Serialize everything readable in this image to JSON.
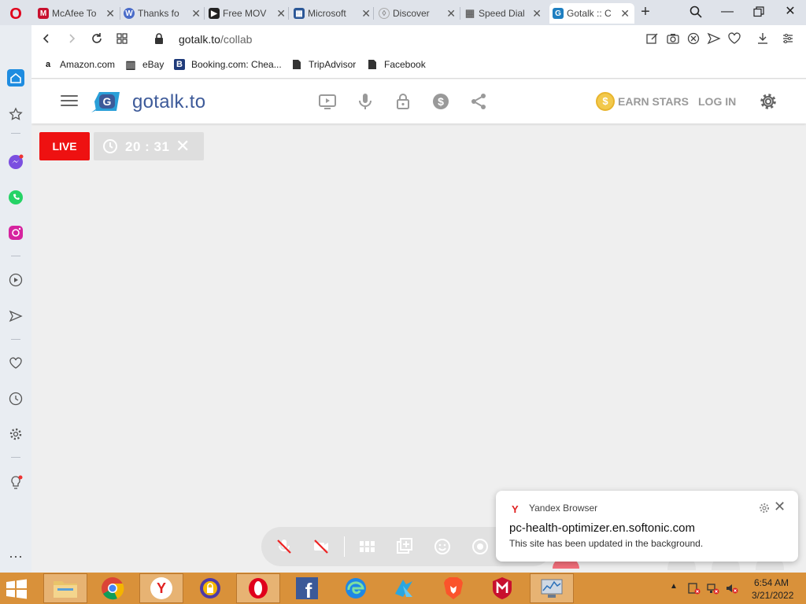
{
  "browser": {
    "logo_icon": "opera-logo-icon",
    "tabs": [
      {
        "title": "McAfee To",
        "favicon_color": "#c8102e",
        "favicon_glyph": "M",
        "active": false
      },
      {
        "title": "Thanks fo",
        "favicon_color": "#4a6cc9",
        "favicon_glyph": "W",
        "active": false
      },
      {
        "title": "Free MOV",
        "favicon_color": "#222222",
        "favicon_glyph": "▶",
        "active": false
      },
      {
        "title": "Microsoft",
        "favicon_color": "#2b5797",
        "favicon_glyph": "▦",
        "active": false
      },
      {
        "title": "Discover",
        "favicon_color": "#ffffff",
        "favicon_glyph": "◊",
        "active": false
      },
      {
        "title": "Speed Dial",
        "favicon_color": "#666666",
        "favicon_glyph": "▦",
        "active": false
      },
      {
        "title": "Gotalk :: C",
        "favicon_color": "#1e7fc1",
        "favicon_glyph": "G",
        "active": true
      }
    ],
    "new_tab": "+",
    "url_host": "gotalk.to",
    "url_path": "/collab",
    "bookmarks": [
      {
        "label": "Amazon.com",
        "icon": "amazon-icon",
        "glyph": "a"
      },
      {
        "label": "eBay",
        "icon": "ebay-icon",
        "glyph": "▥"
      },
      {
        "label": "Booking.com: Chea...",
        "icon": "booking-icon",
        "glyph": "B"
      },
      {
        "label": "TripAdvisor",
        "icon": "file-icon",
        "glyph": ""
      },
      {
        "label": "Facebook",
        "icon": "file-icon",
        "glyph": ""
      }
    ]
  },
  "site": {
    "brand": "gotalk.to",
    "earn_stars": "EARN STARS",
    "coin_glyph": "$",
    "login": "LOG IN",
    "live": "LIVE",
    "timer": "20 : 31",
    "timer_close": "✕",
    "accent": "#3d5a99"
  },
  "notification": {
    "app": "Yandex Browser",
    "app_glyph": "Y",
    "title": "pc-health-optimizer.en.softonic.com",
    "body": "This site has been updated in the background."
  },
  "taskbar": {
    "apps": [
      "file-explorer",
      "chrome",
      "yandex",
      "vpn",
      "opera",
      "facebook",
      "edge",
      "x-app",
      "brave",
      "mcafee",
      "system-monitor"
    ],
    "time": "6:54 AM",
    "date": "3/21/2022"
  }
}
